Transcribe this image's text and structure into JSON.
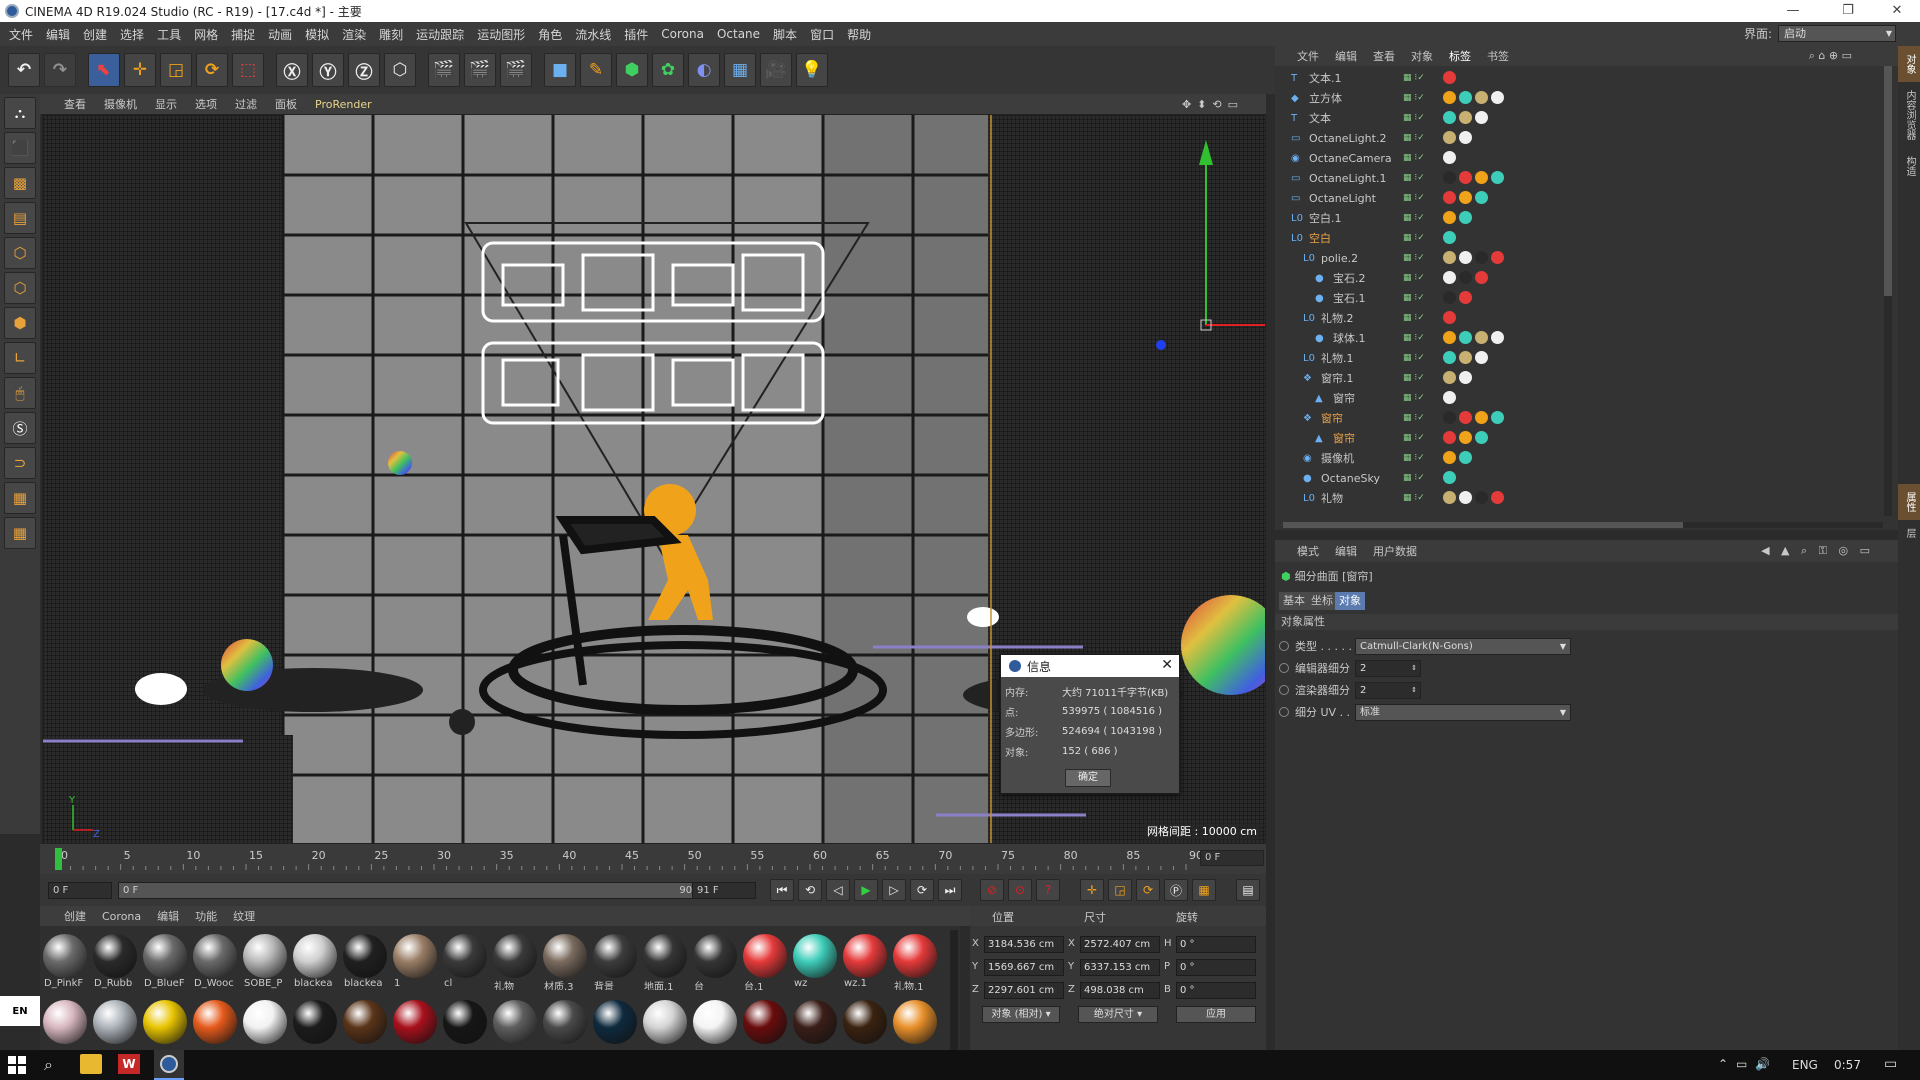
{
  "window": {
    "title": "CINEMA 4D R19.024 Studio (RC - R19) - [17.c4d *] - 主要",
    "min": "—",
    "max": "❐",
    "close": "✕"
  },
  "menu": [
    "文件",
    "编辑",
    "创建",
    "选择",
    "工具",
    "网格",
    "捕捉",
    "动画",
    "模拟",
    "渲染",
    "雕刻",
    "运动跟踪",
    "运动图形",
    "角色",
    "流水线",
    "插件",
    "Corona",
    "Octane",
    "脚本",
    "窗口",
    "帮助"
  ],
  "layout": {
    "label": "界面:",
    "value": "启动"
  },
  "viewport": {
    "menu": [
      "查看",
      "摄像机",
      "显示",
      "选项",
      "过滤",
      "面板",
      "ProRender"
    ],
    "grid_label": "网格间距 : 10000 cm",
    "axis_y": "Y",
    "axis_z": "Z"
  },
  "info_dialog": {
    "title": "信息",
    "rows": [
      {
        "k": "内存:",
        "v": "大约 71011千字节(KB)"
      },
      {
        "k": "点:",
        "v": "539975 ( 1084516 )"
      },
      {
        "k": "多边形:",
        "v": "524694 ( 1043198 )"
      },
      {
        "k": "对象:",
        "v": "152 ( 686 )"
      }
    ],
    "ok": "确定"
  },
  "timeline": {
    "ticks": [
      "0",
      "5",
      "10",
      "15",
      "20",
      "25",
      "30",
      "35",
      "40",
      "45",
      "50",
      "55",
      "60",
      "65",
      "70",
      "75",
      "80",
      "85",
      "90"
    ],
    "current": "0 F",
    "start": "0 F",
    "range_start": "0 F",
    "range_end": "90 F",
    "end": "91 F"
  },
  "materials": {
    "menu": [
      "创建",
      "Corona",
      "编辑",
      "功能",
      "纹理"
    ],
    "items": [
      {
        "label": "D_PinkF",
        "color": "#6a6a6a"
      },
      {
        "label": "D_Rubb",
        "color": "#2a2a2a"
      },
      {
        "label": "D_BlueF",
        "color": "#6a6a6a"
      },
      {
        "label": "D_Wooc",
        "color": "#6a6a6a"
      },
      {
        "label": "SOBE_P",
        "color": "#b9b9b9"
      },
      {
        "label": "blackea",
        "color": "#cfcfcf"
      },
      {
        "label": "blackea",
        "color": "#202020"
      },
      {
        "label": "1",
        "color": "#9a7e66"
      },
      {
        "label": "cl",
        "color": "#3a3a3a"
      },
      {
        "label": "礼物",
        "color": "#3a3a3a"
      },
      {
        "label": "材质.3",
        "color": "#7a6b5e"
      },
      {
        "label": "背景",
        "color": "#3c3c3c"
      },
      {
        "label": "地面.1",
        "color": "#353535"
      },
      {
        "label": "台",
        "color": "#353535"
      },
      {
        "label": "台.1",
        "color": "#e53a3a"
      },
      {
        "label": "wz",
        "color": "#3ecdb9"
      },
      {
        "label": "wz.1",
        "color": "#e53a3a"
      },
      {
        "label": "礼物.1",
        "color": "#e53a3a"
      }
    ],
    "row2": [
      "#d8b8c0",
      "#aeb4bb",
      "#e8c400",
      "#e55a1c",
      "#f2f2f2",
      "#1c1c1c",
      "#5a3418",
      "#a8101c",
      "#161616",
      "#5e5e5e",
      "#4a4a4a",
      "#0e2a3e",
      "#d4d4d4",
      "#f4f4f4",
      "#6a0c0c",
      "#3a1e18",
      "#3a2210",
      "#e8902a"
    ]
  },
  "coords": {
    "headers": [
      "位置",
      "尺寸",
      "旋转"
    ],
    "x_pos": "3184.536 cm",
    "y_pos": "1569.667 cm",
    "z_pos": "2297.601 cm",
    "x_size": "2572.407 cm",
    "y_size": "6337.153 cm",
    "z_size": "498.038 cm",
    "h": "0 °",
    "p": "0 °",
    "b": "0 °",
    "mode": "对象 (相对)",
    "size_mode": "绝对尺寸",
    "apply": "应用",
    "lx": "X",
    "ly": "Y",
    "lz": "Z",
    "lh": "H",
    "lp": "P",
    "lb": "B"
  },
  "objects": {
    "menu": [
      "文件",
      "编辑",
      "查看",
      "对象",
      "标签",
      "书签"
    ],
    "rows": [
      {
        "name": "文本.1",
        "indent": 0,
        "icon": "T"
      },
      {
        "name": "立方体",
        "indent": 0,
        "icon": "◆"
      },
      {
        "name": "文本",
        "indent": 0,
        "icon": "T"
      },
      {
        "name": "OctaneLight.2",
        "indent": 0,
        "icon": "▭"
      },
      {
        "name": "OctaneCamera",
        "indent": 0,
        "icon": "◉"
      },
      {
        "name": "OctaneLight.1",
        "indent": 0,
        "icon": "▭"
      },
      {
        "name": "OctaneLight",
        "indent": 0,
        "icon": "▭"
      },
      {
        "name": "空白.1",
        "indent": 0,
        "icon": "L0"
      },
      {
        "name": "空白",
        "indent": 0,
        "icon": "L0",
        "hl": true
      },
      {
        "name": "polie.2",
        "indent": 1,
        "icon": "L0"
      },
      {
        "name": "宝石.2",
        "indent": 2,
        "icon": "●"
      },
      {
        "name": "宝石.1",
        "indent": 2,
        "icon": "●"
      },
      {
        "name": "礼物.2",
        "indent": 1,
        "icon": "L0"
      },
      {
        "name": "球体.1",
        "indent": 2,
        "icon": "●"
      },
      {
        "name": "礼物.1",
        "indent": 1,
        "icon": "L0"
      },
      {
        "name": "窗帘.1",
        "indent": 1,
        "icon": "❖"
      },
      {
        "name": "窗帘",
        "indent": 2,
        "icon": "▲"
      },
      {
        "name": "窗帘",
        "indent": 1,
        "icon": "❖",
        "hl": true
      },
      {
        "name": "窗帘",
        "indent": 2,
        "icon": "▲",
        "hl": true
      },
      {
        "name": "摄像机",
        "indent": 1,
        "icon": "◉"
      },
      {
        "name": "OctaneSky",
        "indent": 1,
        "icon": "●"
      },
      {
        "name": "礼物",
        "indent": 1,
        "icon": "L0"
      }
    ]
  },
  "attributes": {
    "menu": [
      "模式",
      "编辑",
      "用户数据"
    ],
    "object": "细分曲面 [窗帘]",
    "tabs": [
      "基本",
      "坐标",
      "对象"
    ],
    "section": "对象属性",
    "rows": [
      {
        "k": "类型 . . . . .",
        "v": "Catmull-Clark(N-Gons)"
      },
      {
        "k": "编辑器细分",
        "v": "2"
      },
      {
        "k": "渲染器细分",
        "v": "2"
      },
      {
        "k": "细分 UV . .",
        "v": "标准"
      }
    ]
  },
  "right_strip": [
    "对象",
    "内容浏览器",
    "构造",
    "属性",
    "层"
  ],
  "taskbar": {
    "lang": "ENG",
    "time": "0:57",
    "ime": "EN"
  },
  "colors": {
    "accent": "#f0a21a",
    "highlight": "#e8a34a",
    "selection_tab": "#5a7ab0"
  }
}
